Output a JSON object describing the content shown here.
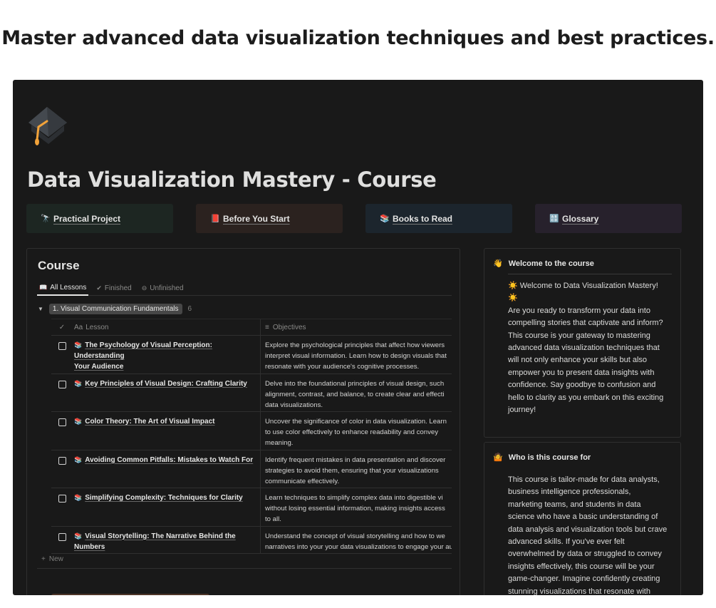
{
  "headline": "Master advanced data visualization techniques and best practices.",
  "page": {
    "icon": "graduation-cap-icon",
    "title": "Data Visualization Mastery - Course"
  },
  "nav_cards": [
    {
      "label": "Practical Project",
      "emoji": "🔭",
      "icon": "telescope-icon",
      "bg": "#1d2622"
    },
    {
      "label": "Before You Start",
      "emoji": "📕",
      "icon": "red-book-icon",
      "bg": "#2b221f"
    },
    {
      "label": "Books to Read",
      "emoji": "📚",
      "icon": "books-icon",
      "bg": "#1c252d"
    },
    {
      "label": "Glossary",
      "emoji": "🔠",
      "icon": "abc-icon",
      "bg": "#27212c"
    }
  ],
  "course": {
    "heading": "Course",
    "tabs": [
      {
        "label": "All Lessons",
        "icon": "open-book-icon",
        "glyph": "📖",
        "active": true
      },
      {
        "label": "Finished",
        "icon": "check-circle-icon",
        "glyph": "✔",
        "active": false
      },
      {
        "label": "Unfinished",
        "icon": "minus-circle-icon",
        "glyph": "⊖",
        "active": false
      }
    ],
    "group": {
      "label": "1. Visual Communication Fundamentals",
      "count": "6"
    },
    "columns": {
      "check": "✓",
      "lesson": "Lesson",
      "lesson_prefix": "Aa",
      "objectives": "Objectives"
    },
    "rows": [
      {
        "lesson": [
          "The Psychology of Visual Perception: Understanding",
          "Your Audience"
        ],
        "objectives": [
          "Explore the psychological principles that affect how viewers",
          "interpret visual information. Learn how to design visuals that",
          "resonate with your audience's cognitive processes."
        ],
        "finished": false
      },
      {
        "lesson": [
          "Key Principles of Visual Design: Crafting Clarity"
        ],
        "objectives": [
          "Delve into the foundational principles of visual design, such",
          "alignment, contrast, and balance, to create clear and effecti",
          "data visualizations."
        ],
        "finished": false
      },
      {
        "lesson": [
          "Color Theory: The Art of Visual Impact"
        ],
        "objectives": [
          "Uncover the significance of color in data visualization. Learn",
          "to use color effectively to enhance readability and convey",
          "meaning."
        ],
        "finished": false
      },
      {
        "lesson": [
          "Avoiding Common Pitfalls: Mistakes to Watch For"
        ],
        "objectives": [
          "Identify frequent mistakes in data presentation and discover",
          "strategies to avoid them, ensuring that your visualizations",
          "communicate effectively."
        ],
        "finished": false
      },
      {
        "lesson": [
          "Simplifying Complexity: Techniques for Clarity"
        ],
        "objectives": [
          "Learn techniques to simplify complex data into digestible vi",
          "without losing essential information, making insights access",
          "to all."
        ],
        "finished": false
      },
      {
        "lesson": [
          "Visual Storytelling: The Narrative Behind the",
          "Numbers"
        ],
        "objectives": [
          "Understand the concept of visual storytelling and how to we",
          "narratives into your your data visualizations to engage your audie"
        ],
        "finished": false
      }
    ],
    "new_label": "New"
  },
  "welcome": {
    "emoji": "👋",
    "title": "Welcome to the course",
    "body": [
      "☀️ Welcome to Data Visualization Mastery!",
      "☀️",
      "Are you ready to transform your data into",
      "compelling stories that captivate and inform?",
      "This course is your gateway to mastering",
      "advanced data visualization techniques that",
      "will not only enhance your skills but also",
      "empower you to present data insights with",
      "confidence. Say goodbye to confusion and",
      "hello to clarity as you embark on this exciting",
      "journey!"
    ]
  },
  "audience": {
    "emoji": "🤷",
    "title": "Who is this course for",
    "body": [
      "This course is tailor-made for data analysts,",
      "business intelligence professionals,",
      "marketing teams, and students in data",
      "science who have a basic understanding of",
      "data analysis and visualization tools but crave",
      "advanced skills. If you've ever felt",
      "overwhelmed by data or struggled to convey",
      "insights effectively, this course will be your",
      "game-changer. Imagine confidently creating",
      "stunning visualizations that resonate with"
    ]
  }
}
